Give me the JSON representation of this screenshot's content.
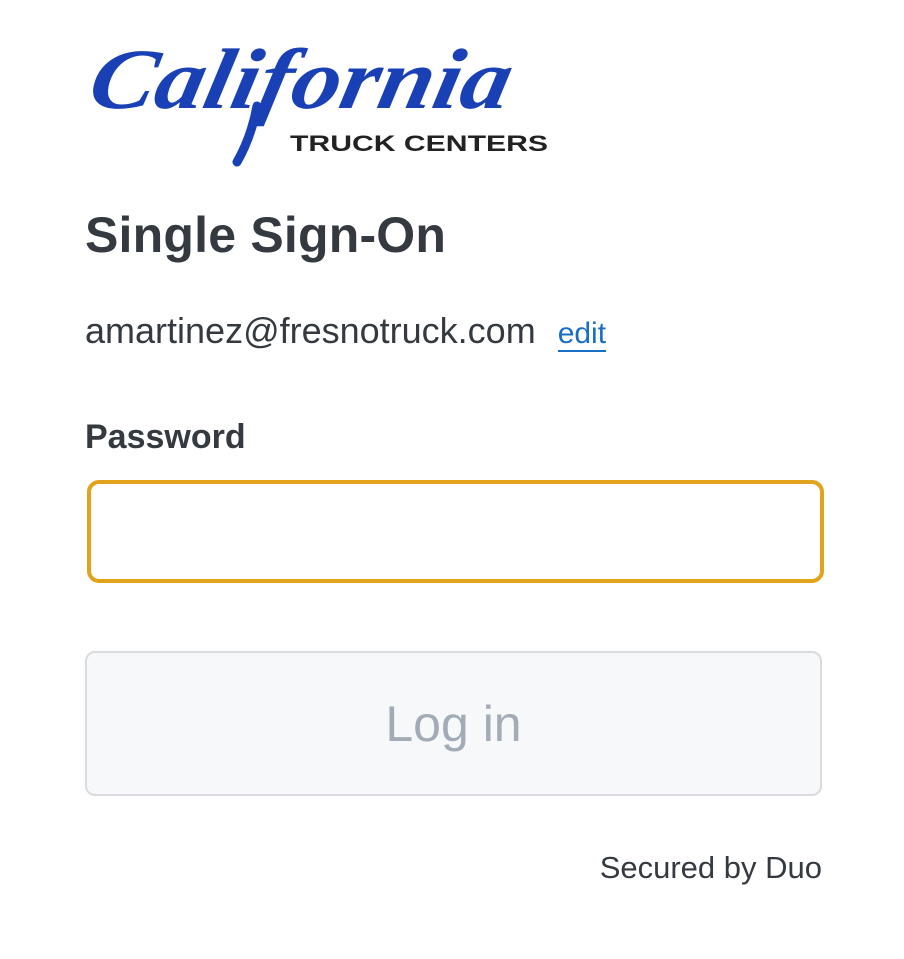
{
  "brand": {
    "logo_script": "California",
    "logo_tagline": "TRUCK CENTERS",
    "logo_color": "#1a40b5",
    "tagline_color": "#222222"
  },
  "page_title": "Single Sign-On",
  "account": {
    "email": "amartinez@fresnotruck.com",
    "edit_label": "edit"
  },
  "password": {
    "label": "Password",
    "value": "",
    "placeholder": ""
  },
  "login_button": {
    "label": "Log in"
  },
  "footer": {
    "secured_text": "Secured by Duo"
  },
  "colors": {
    "focus_border": "#e1a21c",
    "link": "#1a6fc4",
    "text": "#343a40",
    "button_disabled_text": "#a3abb7"
  }
}
